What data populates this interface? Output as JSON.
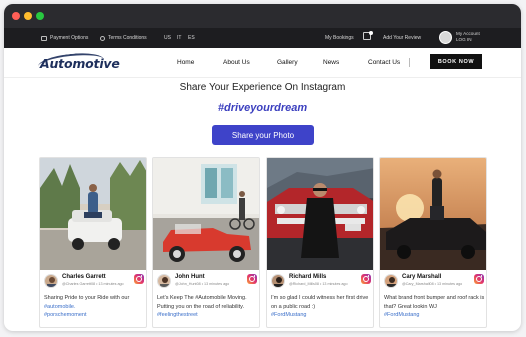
{
  "window": {
    "controls": [
      "close",
      "minimize",
      "maximize"
    ]
  },
  "topbar": {
    "payment": "Payment Options",
    "terms": "Terms Conditions",
    "languages": [
      "US",
      "IT",
      "ES"
    ],
    "bookings": "My Bookings",
    "review": "Add Your Review",
    "account_line1": "My Account",
    "account_line2": "LOG IN"
  },
  "nav": {
    "logo": "Automotive",
    "links": [
      "Home",
      "About Us",
      "Gallery",
      "News",
      "Contact Us"
    ],
    "book_now": "BOOK NOW"
  },
  "main": {
    "heading": "Share Your Experience On Instagram",
    "hashtag": "#driveyourdream",
    "share_button": "Share your Photo"
  },
  "posts": [
    {
      "name": "Charles Garrett",
      "meta": "@Charles Garrett08 • 13 minutes ago",
      "caption": "Sharing Pride to your Ride with our",
      "caption_link": "#automobile.",
      "tag": "#porschemoment"
    },
    {
      "name": "John Hunt",
      "meta": "@John_Hunt08 • 13 minutes ago",
      "caption": "Let's Keep The #Automobile Moving. Putting you on the road of reliability.",
      "caption_link": "",
      "tag": "#feelingthestreet"
    },
    {
      "name": "Richard Mills",
      "meta": "@Richard_Mills08 • 13 minutes ago",
      "caption": "I'm so glad I could witness her first drive on a public road :)",
      "caption_link": "",
      "tag": "#FordMustang"
    },
    {
      "name": "Cary Marshall",
      "meta": "@Cary_Marshall08 • 13 minutes ago",
      "caption": "What brand front bumper and roof rack is that? Great lookin WJ",
      "caption_link": "",
      "tag": "#FordMustang"
    }
  ],
  "colors": {
    "accent": "#3e43c9",
    "hashtag": "#3b3fbf",
    "dark_bar": "#1d1d20",
    "link": "#3b6fc9"
  }
}
